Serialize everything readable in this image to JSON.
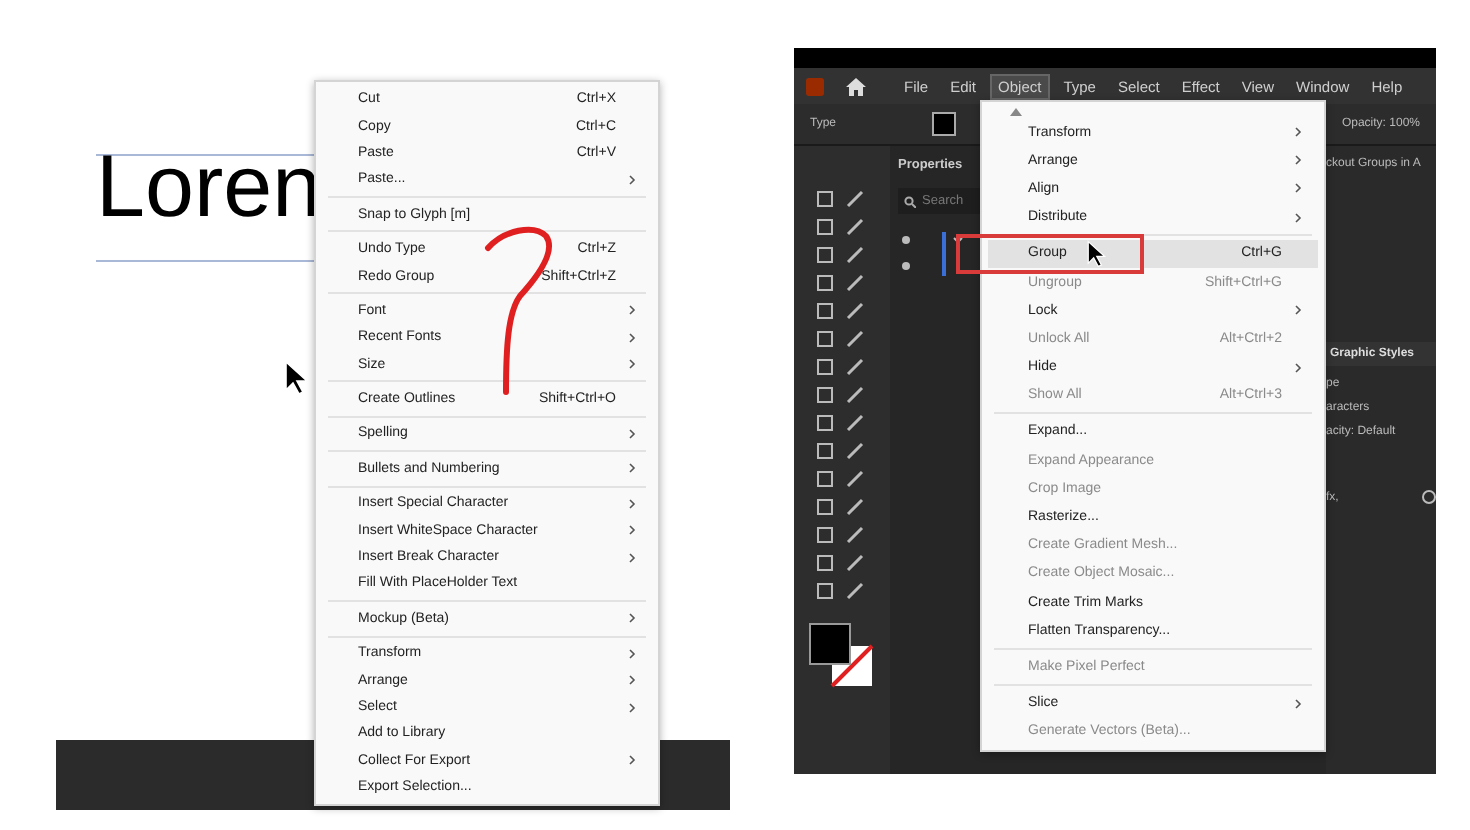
{
  "left_screen": {
    "canvas_text": "Loren",
    "context_menu": [
      {
        "kind": "item",
        "label": "Cut",
        "shortcut": "Ctrl+X",
        "submenu": false
      },
      {
        "kind": "item",
        "label": "Copy",
        "shortcut": "Ctrl+C",
        "submenu": false
      },
      {
        "kind": "item",
        "label": "Paste",
        "shortcut": "Ctrl+V",
        "submenu": false
      },
      {
        "kind": "item",
        "label": "Paste...",
        "submenu": true
      },
      {
        "kind": "separator"
      },
      {
        "kind": "item",
        "label": "Snap to Glyph [m]",
        "submenu": false
      },
      {
        "kind": "separator"
      },
      {
        "kind": "item",
        "label": "Undo Type",
        "shortcut": "Ctrl+Z",
        "submenu": false
      },
      {
        "kind": "item",
        "label": "Redo Group",
        "shortcut": "Shift+Ctrl+Z",
        "submenu": false
      },
      {
        "kind": "separator"
      },
      {
        "kind": "item",
        "label": "Font",
        "submenu": true
      },
      {
        "kind": "item",
        "label": "Recent Fonts",
        "submenu": true
      },
      {
        "kind": "item",
        "label": "Size",
        "submenu": true
      },
      {
        "kind": "separator"
      },
      {
        "kind": "item",
        "label": "Create Outlines",
        "shortcut": "Shift+Ctrl+O",
        "submenu": false
      },
      {
        "kind": "separator"
      },
      {
        "kind": "item",
        "label": "Spelling",
        "submenu": true
      },
      {
        "kind": "separator"
      },
      {
        "kind": "item",
        "label": "Bullets and Numbering",
        "submenu": true
      },
      {
        "kind": "separator"
      },
      {
        "kind": "item",
        "label": "Insert Special Character",
        "submenu": true
      },
      {
        "kind": "item",
        "label": "Insert WhiteSpace Character",
        "submenu": true
      },
      {
        "kind": "item",
        "label": "Insert Break Character",
        "submenu": true
      },
      {
        "kind": "item",
        "label": "Fill With PlaceHolder Text",
        "submenu": false
      },
      {
        "kind": "separator"
      },
      {
        "kind": "item",
        "label": "Mockup (Beta)",
        "submenu": true
      },
      {
        "kind": "separator"
      },
      {
        "kind": "item",
        "label": "Transform",
        "submenu": true
      },
      {
        "kind": "item",
        "label": "Arrange",
        "submenu": true
      },
      {
        "kind": "item",
        "label": "Select",
        "submenu": true
      },
      {
        "kind": "item",
        "label": "Add to Library",
        "submenu": false
      },
      {
        "kind": "item",
        "label": "Collect For Export",
        "submenu": true
      },
      {
        "kind": "item",
        "label": "Export Selection...",
        "submenu": false
      }
    ]
  },
  "right_screen": {
    "menu_bar": [
      {
        "label": "File",
        "selected": false
      },
      {
        "label": "Edit",
        "selected": false
      },
      {
        "label": "Object",
        "selected": true
      },
      {
        "label": "Type",
        "selected": false
      },
      {
        "label": "Select",
        "selected": false
      },
      {
        "label": "Effect",
        "selected": false
      },
      {
        "label": "View",
        "selected": false
      },
      {
        "label": "Window",
        "selected": false
      },
      {
        "label": "Help",
        "selected": false
      }
    ],
    "control_bar": {
      "label": "Type",
      "opacity_label": "Opacity:",
      "opacity_value": "100%"
    },
    "panel_tab": "Properties",
    "search": {
      "placeholder": "Search"
    },
    "side_panel": {
      "header": "ckout Groups in A",
      "tab": "Graphic Styles",
      "rows": [
        "pe",
        "aracters"
      ],
      "opacity_label": "acity:",
      "opacity_value": "Default",
      "fx": "fx,"
    },
    "object_menu": [
      {
        "kind": "item",
        "label": "Transform",
        "submenu": true,
        "disabled": false,
        "highlighted": false
      },
      {
        "kind": "item",
        "label": "Arrange",
        "submenu": true,
        "disabled": false,
        "highlighted": false
      },
      {
        "kind": "item",
        "label": "Align",
        "submenu": true,
        "disabled": false,
        "highlighted": false
      },
      {
        "kind": "item",
        "label": "Distribute",
        "submenu": true,
        "disabled": false,
        "highlighted": false
      },
      {
        "kind": "separator"
      },
      {
        "kind": "item",
        "label": "Group",
        "shortcut": "Ctrl+G",
        "submenu": false,
        "disabled": false,
        "highlighted": true
      },
      {
        "kind": "item",
        "label": "Ungroup",
        "shortcut": "Shift+Ctrl+G",
        "submenu": false,
        "disabled": true,
        "highlighted": false
      },
      {
        "kind": "item",
        "label": "Lock",
        "submenu": true,
        "disabled": false,
        "highlighted": false
      },
      {
        "kind": "item",
        "label": "Unlock All",
        "shortcut": "Alt+Ctrl+2",
        "submenu": false,
        "disabled": true,
        "highlighted": false
      },
      {
        "kind": "item",
        "label": "Hide",
        "submenu": true,
        "disabled": false,
        "highlighted": false
      },
      {
        "kind": "item",
        "label": "Show All",
        "shortcut": "Alt+Ctrl+3",
        "submenu": false,
        "disabled": true,
        "highlighted": false
      },
      {
        "kind": "separator"
      },
      {
        "kind": "item",
        "label": "Expand...",
        "submenu": false,
        "disabled": false,
        "highlighted": false
      },
      {
        "kind": "item",
        "label": "Expand Appearance",
        "submenu": false,
        "disabled": true,
        "highlighted": false
      },
      {
        "kind": "item",
        "label": "Crop Image",
        "submenu": false,
        "disabled": true,
        "highlighted": false
      },
      {
        "kind": "item",
        "label": "Rasterize...",
        "submenu": false,
        "disabled": false,
        "highlighted": false
      },
      {
        "kind": "item",
        "label": "Create Gradient Mesh...",
        "submenu": false,
        "disabled": true,
        "highlighted": false
      },
      {
        "kind": "item",
        "label": "Create Object Mosaic...",
        "submenu": false,
        "disabled": true,
        "highlighted": false
      },
      {
        "kind": "item",
        "label": "Create Trim Marks",
        "submenu": false,
        "disabled": false,
        "highlighted": false
      },
      {
        "kind": "item",
        "label": "Flatten Transparency...",
        "submenu": false,
        "disabled": false,
        "highlighted": false
      },
      {
        "kind": "separator"
      },
      {
        "kind": "item",
        "label": "Make Pixel Perfect",
        "submenu": false,
        "disabled": true,
        "highlighted": false
      },
      {
        "kind": "separator"
      },
      {
        "kind": "item",
        "label": "Slice",
        "submenu": true,
        "disabled": false,
        "highlighted": false
      },
      {
        "kind": "item",
        "label": "Generate Vectors (Beta)...",
        "submenu": false,
        "disabled": true,
        "highlighted": false
      }
    ]
  }
}
